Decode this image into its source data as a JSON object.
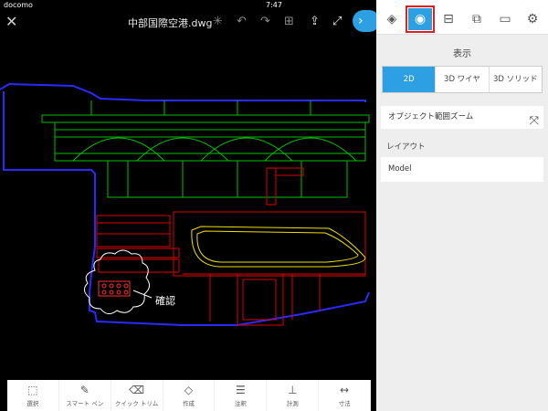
{
  "status": {
    "carrier": "docomo",
    "time": "7:47"
  },
  "topbar": {
    "title": "中部国際空港.dwg"
  },
  "annotation": "確認",
  "bottom_tools": [
    {
      "label": "選択",
      "icon": "select-icon"
    },
    {
      "label": "スマート ペン",
      "icon": "pen-icon"
    },
    {
      "label": "クイック トリム",
      "icon": "eraser-icon"
    },
    {
      "label": "作成",
      "icon": "create-icon"
    },
    {
      "label": "注釈",
      "icon": "note-icon"
    },
    {
      "label": "計測",
      "icon": "measure-icon"
    },
    {
      "label": "寸法",
      "icon": "dimension-icon"
    }
  ],
  "panel": {
    "active_tab": "view-icon",
    "section_title": "表示",
    "view_modes": [
      "2D",
      "3D ワイヤ",
      "3D ソリッド"
    ],
    "active_mode": "2D",
    "zoom_extents": "オブジェクト範囲ズーム",
    "layout_title": "レイアウト",
    "layout_value": "Model"
  },
  "colors": {
    "accent": "#2d9fe3",
    "highlight": "#e02020"
  }
}
